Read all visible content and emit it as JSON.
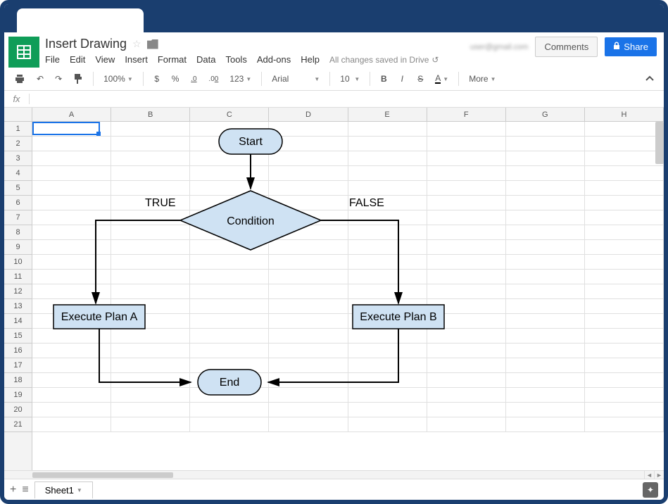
{
  "doc": {
    "title": "Insert Drawing",
    "email": "user@gmail.com",
    "save_status": "All changes saved in Drive"
  },
  "menubar": {
    "file": "File",
    "edit": "Edit",
    "view": "View",
    "insert": "Insert",
    "format": "Format",
    "data": "Data",
    "tools": "Tools",
    "addons": "Add-ons",
    "help": "Help"
  },
  "header_buttons": {
    "comments": "Comments",
    "share": "Share"
  },
  "toolbar": {
    "zoom": "100%",
    "currency": "$",
    "percent": "%",
    "dec_dec": ".0",
    "inc_dec": ".00",
    "num_format": "123",
    "font": "Arial",
    "font_size": "10",
    "bold": "B",
    "italic": "I",
    "strike": "S",
    "text_color": "A",
    "more": "More"
  },
  "formula": {
    "fx": "fx"
  },
  "grid": {
    "columns": [
      "A",
      "B",
      "C",
      "D",
      "E",
      "F",
      "G",
      "H"
    ],
    "rows": [
      "1",
      "2",
      "3",
      "4",
      "5",
      "6",
      "7",
      "8",
      "9",
      "10",
      "11",
      "12",
      "13",
      "14",
      "15",
      "16",
      "17",
      "18",
      "19",
      "20",
      "21"
    ],
    "selected_cell": "A1"
  },
  "flowchart": {
    "start": "Start",
    "condition": "Condition",
    "true_label": "TRUE",
    "false_label": "FALSE",
    "plan_a": "Execute Plan A",
    "plan_b": "Execute Plan B",
    "end": "End"
  },
  "sheets": {
    "sheet1": "Sheet1"
  }
}
